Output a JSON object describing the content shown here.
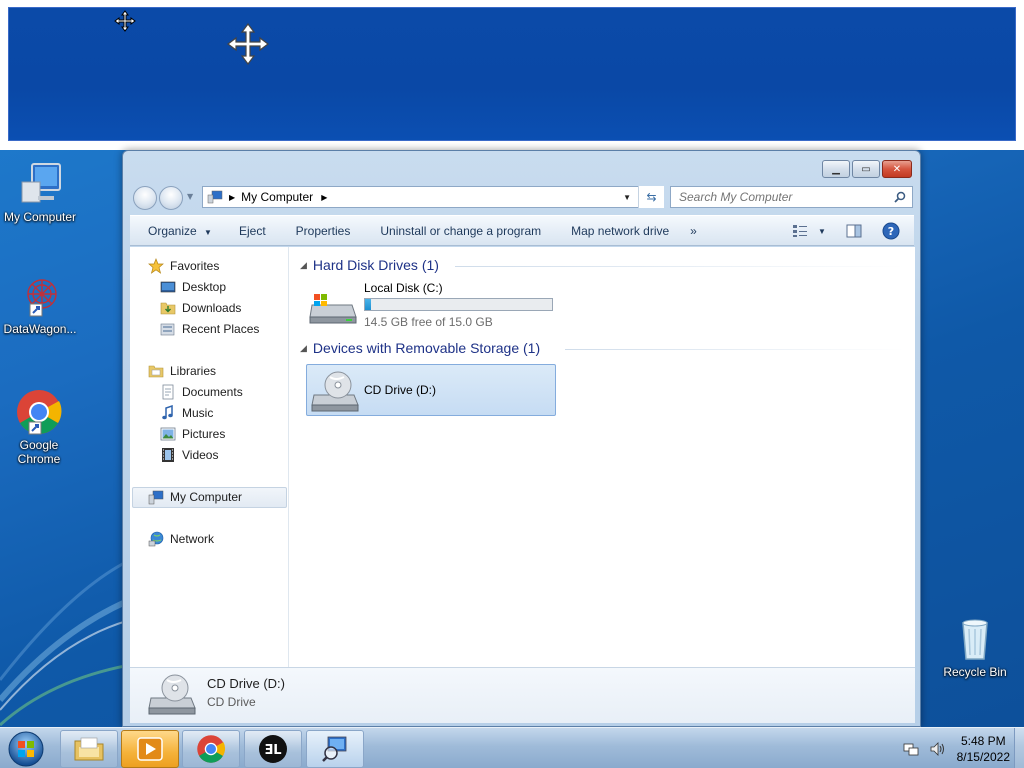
{
  "desktop": {
    "icons": [
      {
        "label": "My Computer"
      },
      {
        "label": "DataWagon..."
      },
      {
        "label": "Google Chrome"
      },
      {
        "label": "Recycle Bin"
      }
    ]
  },
  "explorer": {
    "address": {
      "path": "My Computer"
    },
    "search": {
      "placeholder": "Search My Computer"
    },
    "toolbar": {
      "organize": "Organize",
      "eject": "Eject",
      "properties": "Properties",
      "uninstall": "Uninstall or change a program",
      "map_drive": "Map network drive",
      "more": "»"
    },
    "nav": {
      "favorites": "Favorites",
      "desktop": "Desktop",
      "downloads": "Downloads",
      "recent": "Recent Places",
      "libraries": "Libraries",
      "documents": "Documents",
      "music": "Music",
      "pictures": "Pictures",
      "videos": "Videos",
      "computer": "My Computer",
      "network": "Network"
    },
    "groups": {
      "hard_disks": "Hard Disk Drives (1)",
      "removable": "Devices with Removable Storage (1)"
    },
    "drives": {
      "c": {
        "name": "Local Disk (C:)",
        "free": "14.5 GB free of 15.0 GB",
        "used_fraction": 0.033
      },
      "d": {
        "name": "CD Drive (D:)"
      }
    },
    "details": {
      "name": "CD Drive (D:)",
      "type": "CD Drive"
    }
  },
  "taskbar": {
    "time": "5:48 PM",
    "date": "8/15/2022"
  },
  "colors": {
    "accent": "#1e3287",
    "desktop": "#1b6cc0",
    "banner": "#0b4aa8"
  }
}
